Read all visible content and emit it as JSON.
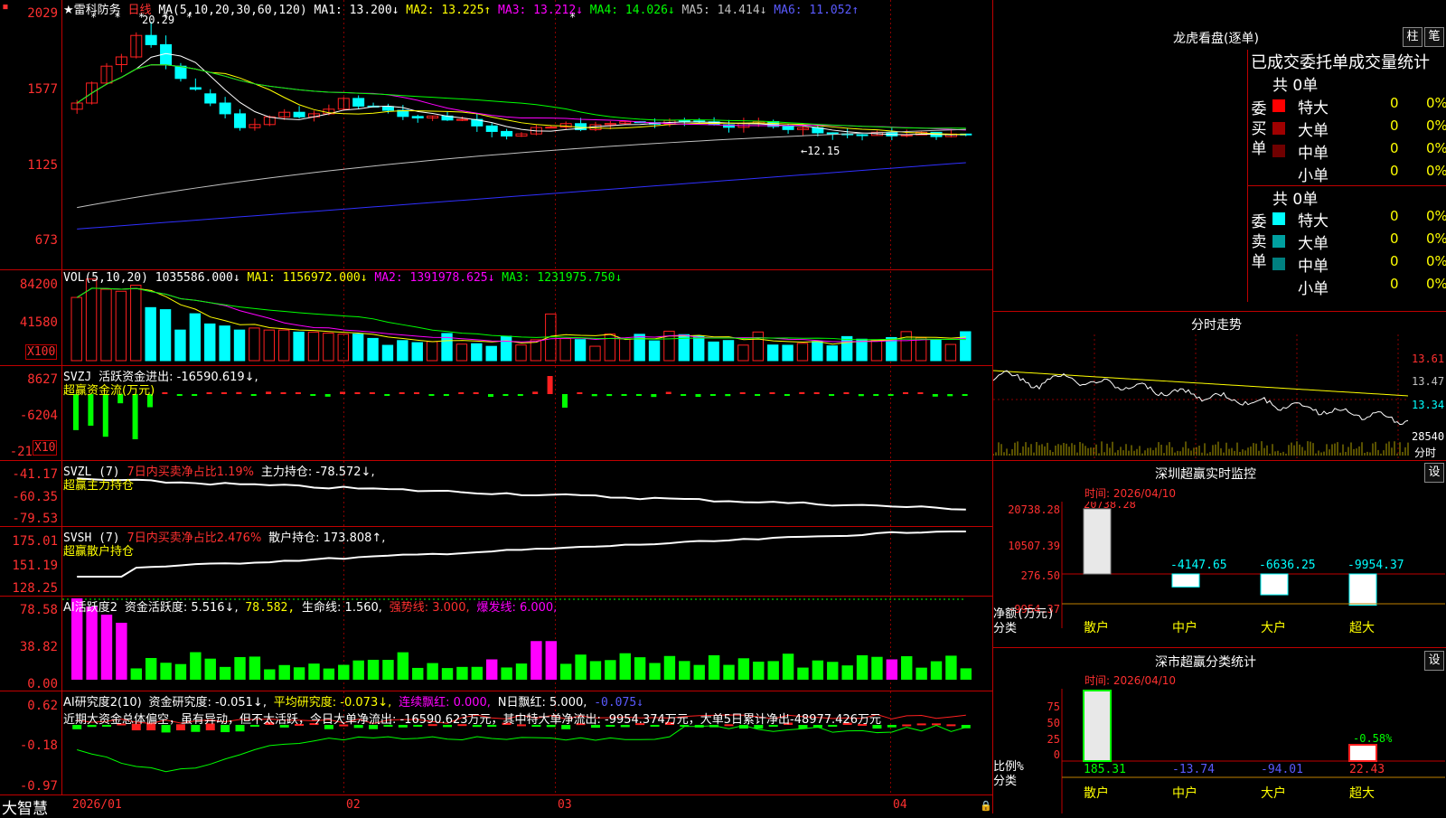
{
  "colors": {
    "up": "#ff2020",
    "down": "#00ffff",
    "frame": "#c00000",
    "ma1": "#ffffff",
    "ma2": "#ffff00",
    "ma3": "#ff00ff",
    "ma4": "#00ff00",
    "ma5": "#c0c0c0",
    "ma6": "#3030ff"
  },
  "header": {
    "stock_name": "雷科防务",
    "period": "日线",
    "ma_params": "MA(5,10,20,30,60,120)",
    "ma1": "MA1: 13.200↓",
    "ma2": "MA2: 13.225↑",
    "ma3": "MA3: 13.212↓",
    "ma4": "MA4: 14.026↓",
    "ma5": "MA5: 14.414↓",
    "ma6": "MA6: 11.052↑",
    "high_mark": "20.29",
    "low_mark": "←12.15"
  },
  "price_axis": [
    "2029",
    "1577",
    "1125",
    "673"
  ],
  "vol": {
    "label": "VOL(5,10,20)",
    "val": "1035586.000↓",
    "ma1": "MA1: 1156972.000↓",
    "ma2": "MA2: 1391978.625↓",
    "ma3": "MA3: 1231975.750↓",
    "axis": [
      "84200",
      "41580"
    ],
    "mult": "X100"
  },
  "svzj": {
    "label": "SVZJ",
    "title": "活跃资金进出: -16590.619↓,",
    "sub": "超赢资金流(万元)",
    "axis": [
      "8627",
      "-6204",
      "-21"
    ],
    "mult": "X10"
  },
  "svzl": {
    "label": "SVZL (7)",
    "t1": "7日内买卖净占比1.19%",
    "t2": "主力持仓: -78.572↓,",
    "sub": "超赢主力持仓",
    "axis": [
      "-41.17",
      "-60.35",
      "-79.53"
    ]
  },
  "svsh": {
    "label": "SVSH (7)",
    "t1": "7日内买卖净占比2.476%",
    "t2": "散户持仓: 173.808↑,",
    "sub": "超赢散户持仓",
    "axis": [
      "175.01",
      "151.19",
      "128.25"
    ]
  },
  "ai1": {
    "label": "AI活跃度2",
    "t1": "资金活跃度: 5.516↓,",
    "t2": "78.582,",
    "t3": "生命线: 1.560,",
    "t4": "强势线: 3.000,",
    "t5": "爆发线: 6.000,",
    "axis": [
      "78.58",
      "38.82",
      "0.00"
    ]
  },
  "ai2": {
    "label": "AI研究度2(10)",
    "t1": "资金研究度: -0.051↓,",
    "t2": "平均研究度: -0.073↓,",
    "t3": "连续飘红: 0.000,",
    "t4": "N日飘红: 5.000,",
    "t5": "-0.075↓",
    "desc": "近期大资金总体偏空，虽有异动，但不太活跃，今日大单净流出: -16590.623万元，其中特大单净流出: -9954.374万元，大单5日累计净出-48977.426万元",
    "axis": [
      "0.62",
      "-0.18",
      "-0.97"
    ]
  },
  "x_axis": [
    "2026/01",
    "02",
    "03",
    "04"
  ],
  "footer": {
    "brand": "大智慧"
  },
  "right": {
    "longhu": {
      "title": "龙虎看盘(逐单)",
      "btn1": "柱",
      "btn2": "笔",
      "subtitle": "已成交委托单成交量统计",
      "buy_label": "委买单",
      "sell_label": "委卖单",
      "buy_total": "共 0单",
      "sell_total": "共 0单",
      "buy_rows": [
        {
          "name": "特大",
          "n": "0",
          "p": "0%",
          "c": "#ff0000"
        },
        {
          "name": "大单",
          "n": "0",
          "p": "0%",
          "c": "#a00000"
        },
        {
          "name": "中单",
          "n": "0",
          "p": "0%",
          "c": "#700000"
        },
        {
          "name": "小单",
          "n": "0",
          "p": "0%",
          "c": ""
        }
      ],
      "sell_rows": [
        {
          "name": "特大",
          "n": "0",
          "p": "0%",
          "c": "#00ffff"
        },
        {
          "name": "大单",
          "n": "0",
          "p": "0%",
          "c": "#00a0a0"
        },
        {
          "name": "中单",
          "n": "0",
          "p": "0%",
          "c": "#008080"
        },
        {
          "name": "小单",
          "n": "0",
          "p": "0%",
          "c": ""
        }
      ]
    },
    "fenshi": {
      "title": "分时走势",
      "axis": [
        "13.61",
        "13.47",
        "13.34",
        "28540"
      ],
      "unit": "分时"
    },
    "monitor": {
      "title": "深圳超赢实时监控",
      "btn": "设",
      "time": "时间: 2026/04/10",
      "axis": [
        "20738.28",
        "10507.39",
        "276.50",
        "-9954.37"
      ],
      "top_label": "20738.28",
      "ylabel": "净额(万元)",
      "xlabel": "分类",
      "cats": [
        "散户",
        "中户",
        "大户",
        "超大"
      ],
      "values": [
        20738.28,
        -4147.65,
        -6636.25,
        -9954.37
      ],
      "labels": [
        "",
        "-4147.65",
        "-6636.25",
        "-9954.37"
      ]
    },
    "classify": {
      "title": "深市超赢分类统计",
      "btn": "设",
      "time": "时间: 2026/04/10",
      "axis": [
        "75",
        "50",
        "25",
        "0"
      ],
      "ylabel": "比例%",
      "xlabel": "分类",
      "cats": [
        "散户",
        "中户",
        "大户",
        "超大"
      ],
      "values": [
        185.31,
        -13.74,
        -94.01,
        22.43
      ],
      "pct_label": "-0.58%"
    }
  },
  "chart_data": {
    "type": "candlestick",
    "categories": [
      "2026/01",
      "02",
      "03",
      "04"
    ],
    "price_axis": [
      "2029",
      "1577",
      "1125",
      "673"
    ],
    "candles": [
      [
        14.6,
        15.2,
        14.3,
        15.0
      ],
      [
        15.0,
        16.4,
        14.9,
        16.3
      ],
      [
        16.3,
        17.6,
        16.2,
        17.4
      ],
      [
        17.5,
        18.2,
        17.0,
        18.0
      ],
      [
        18.0,
        19.6,
        17.9,
        19.4
      ],
      [
        19.4,
        20.29,
        18.6,
        18.8
      ],
      [
        18.8,
        19.4,
        17.2,
        17.5
      ],
      [
        17.4,
        17.6,
        16.4,
        16.6
      ],
      [
        16.0,
        16.6,
        15.8,
        15.9
      ],
      [
        15.6,
        15.9,
        14.8,
        15.0
      ],
      [
        15.0,
        15.4,
        14.0,
        14.3
      ],
      [
        14.3,
        14.6,
        13.2,
        13.4
      ],
      [
        13.4,
        14.0,
        13.2,
        13.6
      ],
      [
        13.6,
        14.2,
        13.5,
        14.1
      ],
      [
        14.1,
        14.6,
        13.9,
        14.4
      ],
      [
        14.4,
        14.8,
        14.0,
        14.1
      ],
      [
        14.1,
        14.5,
        13.8,
        14.3
      ],
      [
        14.3,
        14.9,
        14.2,
        14.6
      ],
      [
        14.6,
        15.4,
        14.5,
        15.3
      ],
      [
        15.3,
        15.5,
        14.6,
        14.8
      ]
    ],
    "volume": [
      62000,
      80000,
      70000,
      68000,
      74000,
      52000,
      50000,
      30000,
      46000,
      36000,
      34000,
      30000,
      32000,
      30000,
      30000,
      28000,
      28000,
      27000,
      26000,
      26000
    ],
    "fenshi": [
      13.45,
      13.44,
      13.43,
      13.41,
      13.39,
      13.38,
      13.36,
      13.35,
      13.34
    ]
  }
}
